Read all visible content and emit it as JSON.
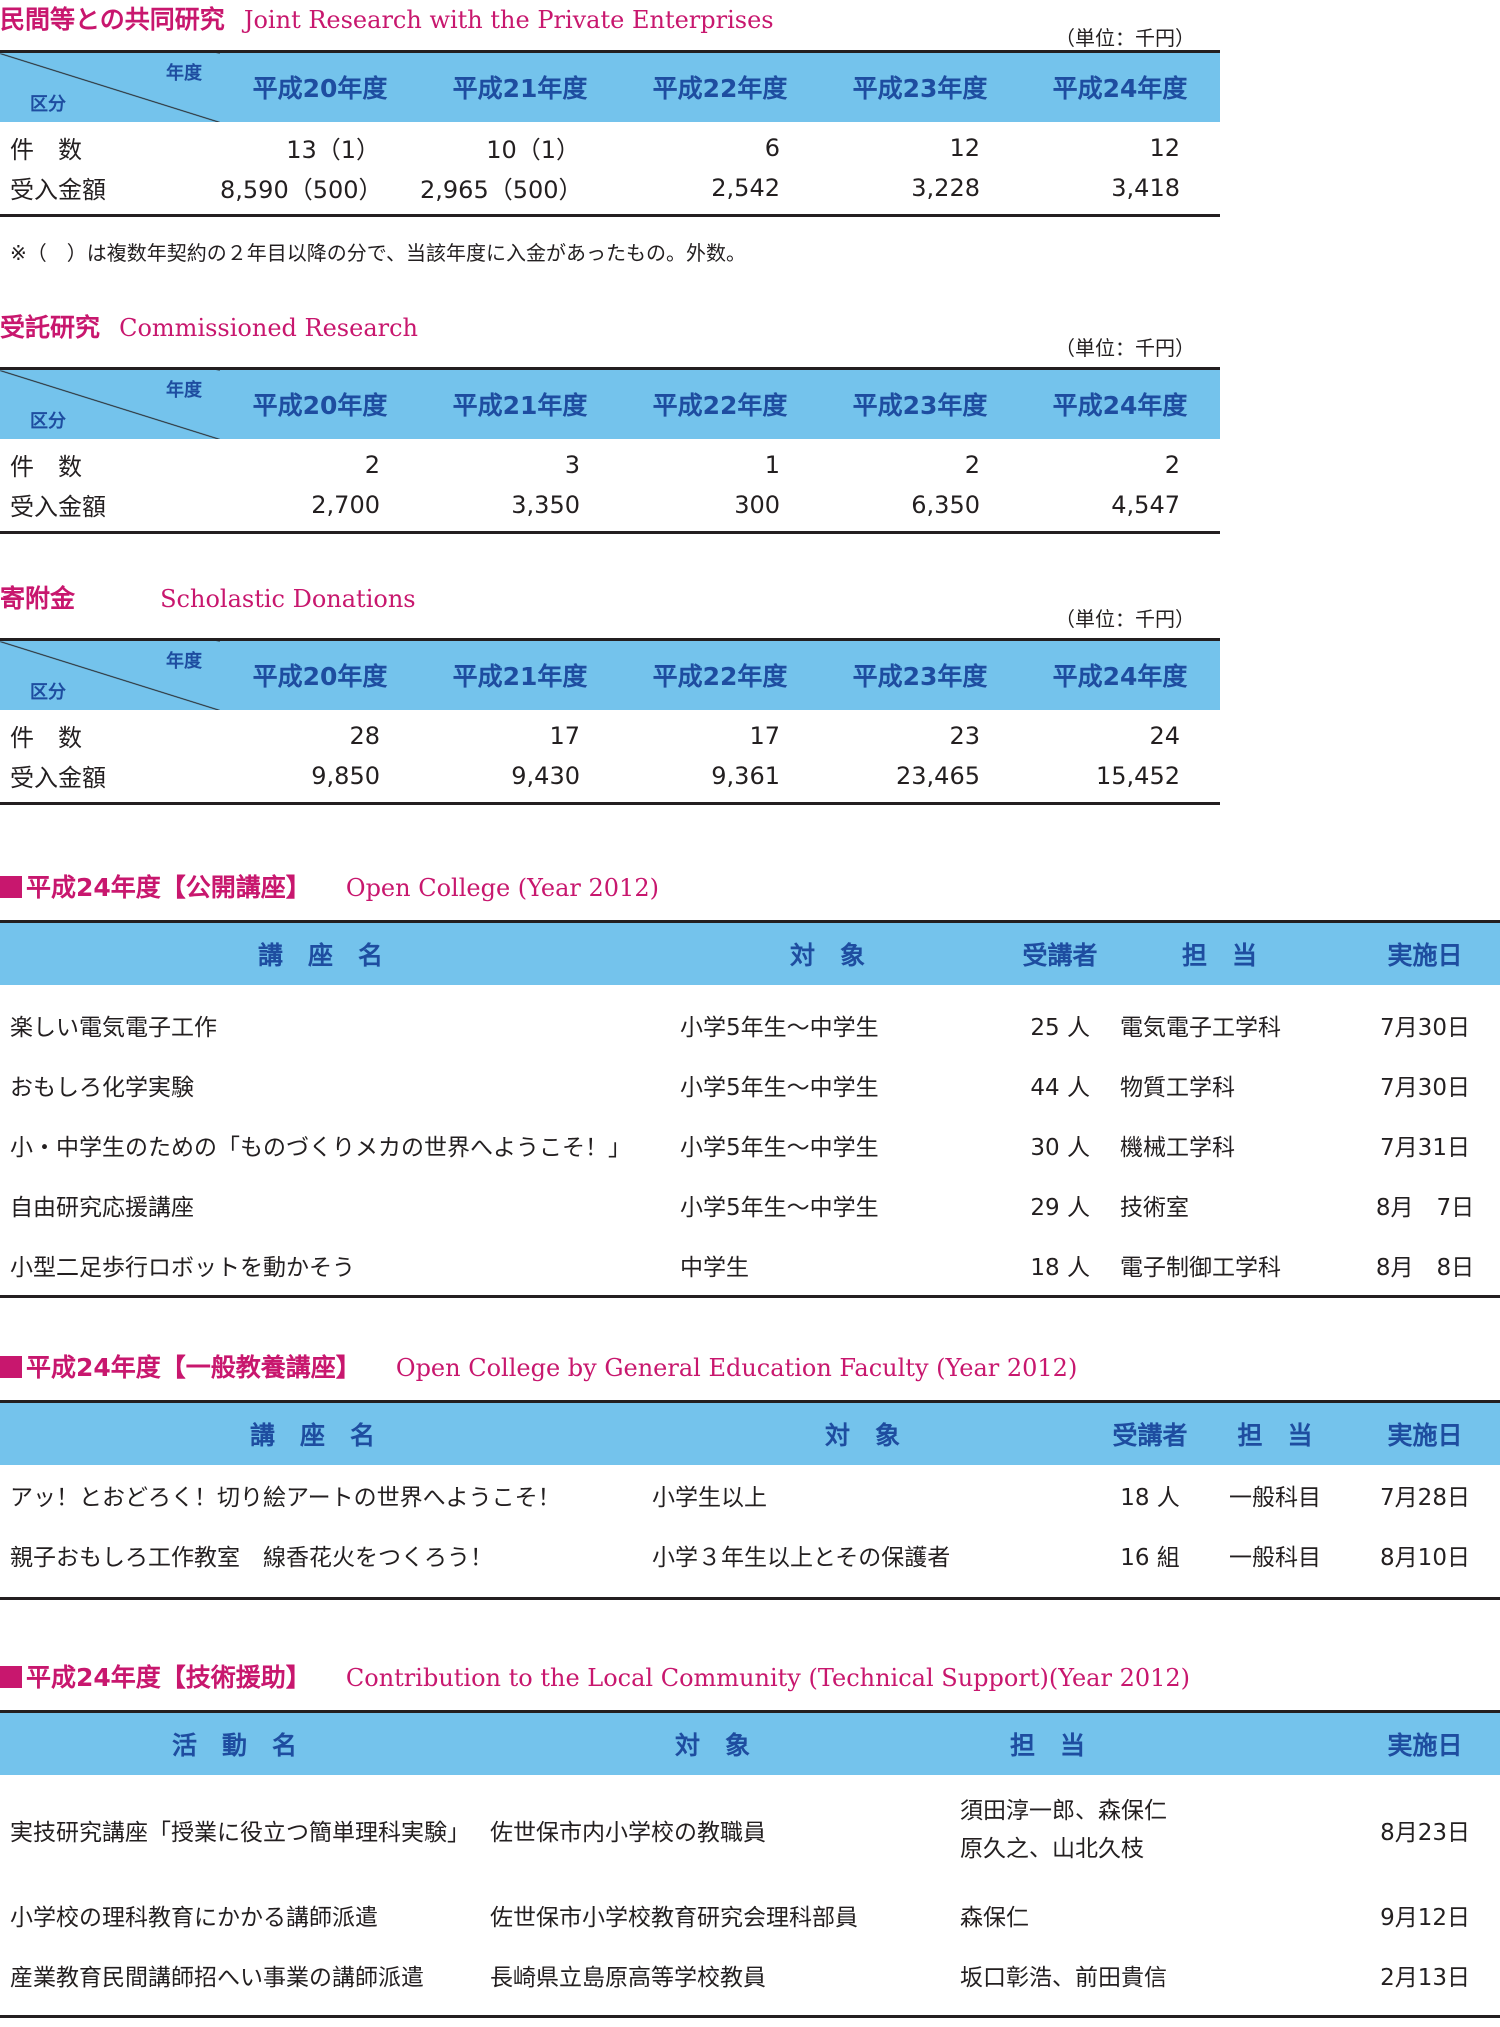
{
  "joint": {
    "jp_title": "民間等との共同研究",
    "en_title": "Joint Research with the Private Enterprises",
    "unit": "（単位：千円）",
    "corner_top": "年度",
    "corner_bottom": "区分",
    "years": [
      "平成20年度",
      "平成21年度",
      "平成22年度",
      "平成23年度",
      "平成24年度"
    ],
    "rows": [
      {
        "label": "件　数",
        "values": [
          "13（1）",
          "10（1）",
          "6",
          "12",
          "12"
        ]
      },
      {
        "label": "受入金額",
        "values": [
          "8,590（500）",
          "2,965（500）",
          "2,542",
          "3,228",
          "3,418"
        ]
      }
    ],
    "note": "※（　）は複数年契約の２年目以降の分で、当該年度に入金があったもの。外数。"
  },
  "commissioned": {
    "jp_title": "受託研究",
    "en_title": "Commissioned Research",
    "unit": "（単位：千円）",
    "corner_top": "年度",
    "corner_bottom": "区分",
    "years": [
      "平成20年度",
      "平成21年度",
      "平成22年度",
      "平成23年度",
      "平成24年度"
    ],
    "rows": [
      {
        "label": "件　数",
        "values": [
          "2",
          "3",
          "1",
          "2",
          "2"
        ]
      },
      {
        "label": "受入金額",
        "values": [
          "2,700",
          "3,350",
          "300",
          "6,350",
          "4,547"
        ]
      }
    ]
  },
  "donations": {
    "jp_title": "寄附金",
    "en_title": "Scholastic Donations",
    "unit": "（単位：千円）",
    "corner_top": "年度",
    "corner_bottom": "区分",
    "years": [
      "平成20年度",
      "平成21年度",
      "平成22年度",
      "平成23年度",
      "平成24年度"
    ],
    "rows": [
      {
        "label": "件　数",
        "values": [
          "28",
          "17",
          "17",
          "23",
          "24"
        ]
      },
      {
        "label": "受入金額",
        "values": [
          "9,850",
          "9,430",
          "9,361",
          "23,465",
          "15,452"
        ]
      }
    ]
  },
  "open_college": {
    "jp_title": "平成24年度【公開講座】",
    "en_title": "Open College (Year 2012)",
    "headers": [
      "講　座　名",
      "対　象",
      "受講者",
      "担　当",
      "実施日"
    ],
    "rows": [
      [
        "楽しい電気電子工作",
        "小学5年生～中学生",
        "25 人",
        "電気電子工学科",
        "7月30日"
      ],
      [
        "おもしろ化学実験",
        "小学5年生～中学生",
        "44 人",
        "物質工学科",
        "7月30日"
      ],
      [
        "小・中学生のための「ものづくりメカの世界へようこそ！」",
        "小学5年生～中学生",
        "30 人",
        "機械工学科",
        "7月31日"
      ],
      [
        "自由研究応援講座",
        "小学5年生～中学生",
        "29 人",
        "技術室",
        "8月　7日"
      ],
      [
        "小型二足歩行ロボットを動かそう",
        "中学生",
        "18 人",
        "電子制御工学科",
        "8月　8日"
      ]
    ]
  },
  "general_college": {
    "jp_title": "平成24年度【一般教養講座】",
    "en_title": "Open College by General Education Faculty (Year 2012)",
    "headers": [
      "講　座　名",
      "対　象",
      "受講者",
      "担　当",
      "実施日"
    ],
    "rows": [
      [
        "アッ！とおどろく！切り絵アートの世界へようこそ！",
        "小学生以上",
        "18 人",
        "一般科目",
        "7月28日"
      ],
      [
        "親子おもしろ工作教室　線香花火をつくろう！",
        "小学３年生以上とその保護者",
        "16 組",
        "一般科目",
        "8月10日"
      ]
    ]
  },
  "tech_support": {
    "jp_title": "平成24年度【技術援助】",
    "en_title": "Contribution to the Local Community (Technical Support)(Year 2012)",
    "headers": [
      "活　動　名",
      "対　象",
      "担　当",
      "実施日"
    ],
    "rows": [
      [
        "実技研究講座「授業に役立つ簡単理科実験」",
        "佐世保市内小学校の教職員",
        "須田淳一郎、森保仁",
        "原久之、山北久枝",
        "8月23日"
      ],
      [
        "小学校の理科教育にかかる講師派遣",
        "佐世保市小学校教育研究会理科部員",
        "森保仁",
        "",
        "9月12日"
      ],
      [
        "産業教育民間講師招へい事業の講師派遣",
        "長崎県立島原高等学校教員",
        "坂口彰浩、前田貴信",
        "",
        "2月13日"
      ]
    ]
  }
}
